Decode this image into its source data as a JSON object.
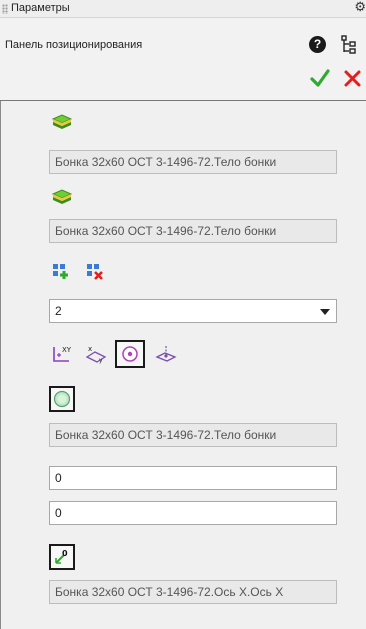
{
  "window": {
    "title": "Параметры",
    "panel_title": "Панель позиционирования"
  },
  "icons": {
    "gear": "gear-icon",
    "help": "help-icon",
    "tree": "tree-icon",
    "ok": "checkmark-icon",
    "cancel": "close-icon"
  },
  "colors": {
    "ok": "#2eaa2e",
    "cancel": "#e02020",
    "layer": "#5cbf2a"
  },
  "body1": {
    "value": "Бонка 32х60 ОСТ 3-1496-72.Тело бонки"
  },
  "body2": {
    "value": "Бонка 32х60 ОСТ 3-1496-72.Тело бонки"
  },
  "dropdown": {
    "value": "2"
  },
  "face": {
    "value": "Бонка 32х60 ОСТ 3-1496-72.Тело бонки"
  },
  "inputs": {
    "first": "0",
    "second": "0"
  },
  "axis": {
    "value": "Бонка 32х60 ОСТ 3-1496-72.Ось Х.Ось Х"
  }
}
